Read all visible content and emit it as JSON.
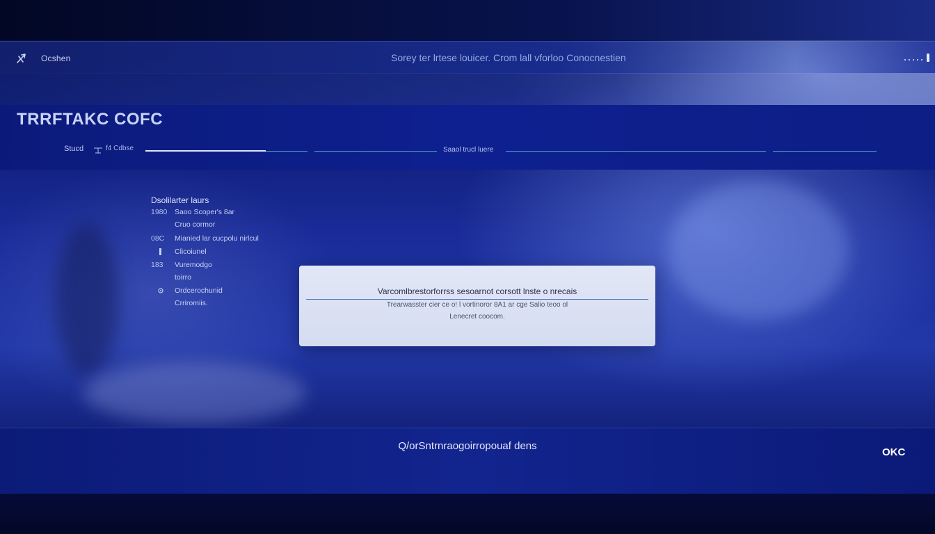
{
  "colors": {
    "accent": "#4f78b8",
    "header_band": "#0e2090",
    "dialog_bg": "#dde3f4",
    "footer_text": "#e3e8fa"
  },
  "topbar": {
    "brand_icon": "arrow-logo-icon",
    "brand_name": "Ocshen",
    "center_text": "Sorey ter lrtese louicer.  Crom lall vforloo  Conocnestien",
    "more_icon": "more-dots-icon"
  },
  "header": {
    "title": "TRRFTAKC COFC",
    "step_label": "Stucd",
    "step_value": "f4 Cdbse",
    "mid_label": "Saaol trucl luere"
  },
  "list": {
    "heading": "Dsolilarter laurs",
    "items": [
      {
        "index": "1980",
        "text": "Saoo Scoper's 8ar"
      },
      {
        "index": "",
        "text": "Cruo cormor"
      },
      {
        "index": "08C",
        "text": "Mianied lar cucpolu nirlcul"
      },
      {
        "index": "",
        "text": "Clicoiunel"
      },
      {
        "index": "183",
        "text": "Vuremodgo"
      },
      {
        "index": "",
        "text": "toirro"
      },
      {
        "index": "",
        "text": "Ordcerochunid"
      },
      {
        "index": "",
        "text": "Crriromiis."
      }
    ]
  },
  "dialog": {
    "title": "Varcomlbrestorforrss  sesoarnot corsott lnste o nrecais",
    "body_line1": "Trearwasster  cier ce o! l vortinoror  8A1 ar cge  Salio teoo ol",
    "body_line2": "Lenecret coocom."
  },
  "footer": {
    "text": "Q/orSntrnraogoirropouaf dens",
    "ok_label": "OKC"
  }
}
